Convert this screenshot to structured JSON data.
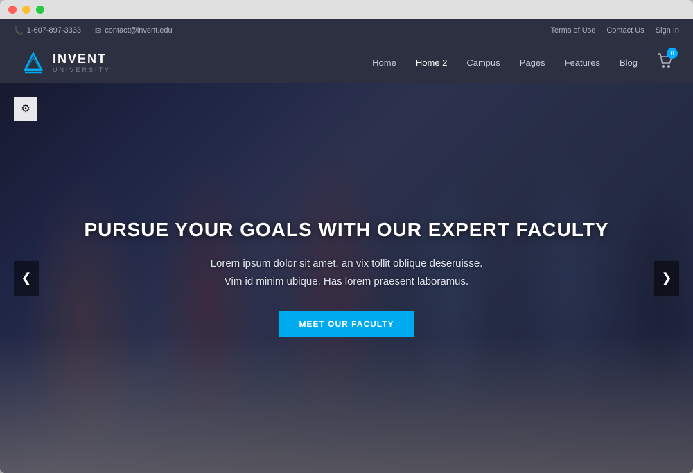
{
  "mac": {
    "titlebar": {
      "close": "close",
      "minimize": "minimize",
      "maximize": "maximize"
    }
  },
  "utility_bar": {
    "phone": "1-607-897-3333",
    "email": "contact@invent.edu",
    "links": [
      {
        "label": "Terms of Use"
      },
      {
        "label": "Contact Us"
      },
      {
        "label": "Sign In"
      }
    ]
  },
  "navbar": {
    "logo_name": "INVENT",
    "logo_subtitle": "UNIVERSITY",
    "nav_items": [
      {
        "label": "Home",
        "active": false
      },
      {
        "label": "Home 2",
        "active": true
      },
      {
        "label": "Campus",
        "active": false
      },
      {
        "label": "Pages",
        "active": false
      },
      {
        "label": "Features",
        "active": false
      },
      {
        "label": "Blog",
        "active": false
      }
    ],
    "cart_count": "0"
  },
  "hero": {
    "title": "PURSUE YOUR GOALS WITH OUR EXPERT FACULTY",
    "subtitle_line1": "Lorem ipsum dolor sit amet, an vix tollit oblique deseruisse.",
    "subtitle_line2": "Vim id minim ubique. Has lorem praesent laboramus.",
    "cta_button": "MEET OUR FACULTY",
    "arrow_left": "❮",
    "arrow_right": "❯",
    "settings_icon": "⚙"
  },
  "colors": {
    "nav_bg": "#2c3040",
    "accent_blue": "#00aaee",
    "utility_bg": "#252836"
  }
}
